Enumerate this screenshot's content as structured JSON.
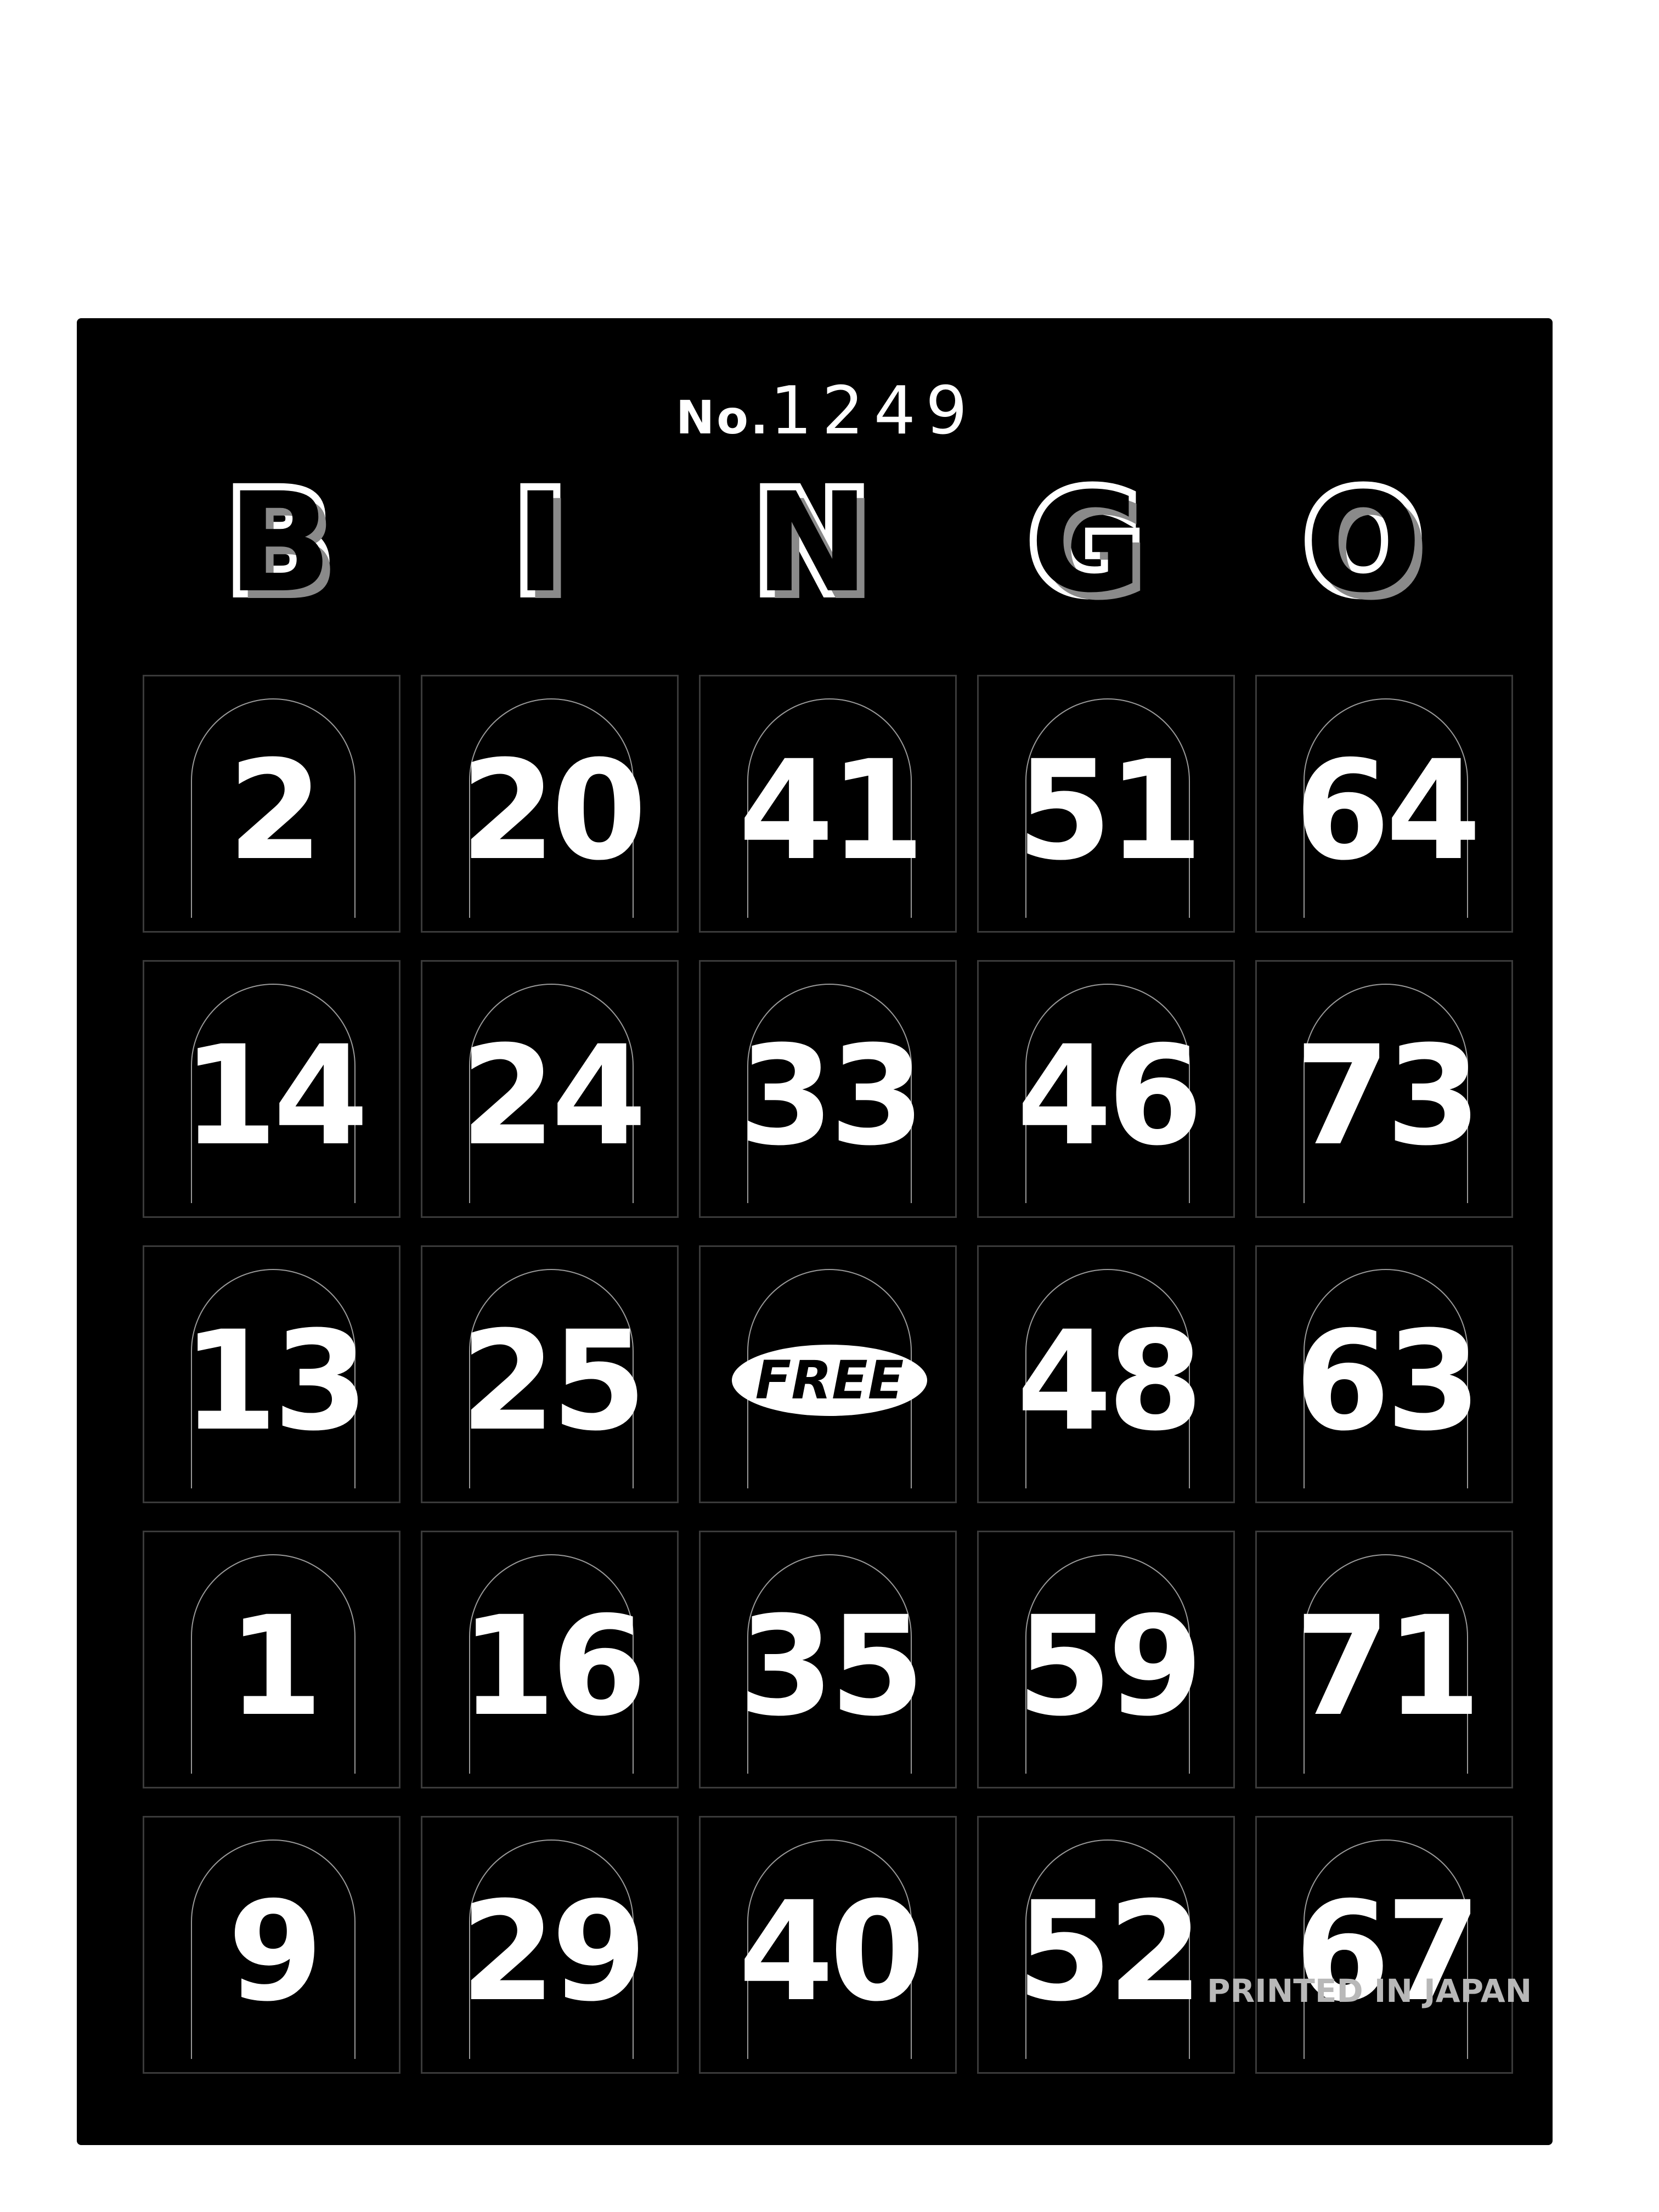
{
  "serial": {
    "label": "No.",
    "number": "1249"
  },
  "header_letters": [
    "B",
    "I",
    "N",
    "G",
    "O"
  ],
  "rows": [
    [
      "2",
      "20",
      "41",
      "51",
      "64"
    ],
    [
      "14",
      "24",
      "33",
      "46",
      "73"
    ],
    [
      "13",
      "25",
      "FREE",
      "48",
      "63"
    ],
    [
      "1",
      "16",
      "35",
      "59",
      "71"
    ],
    [
      "9",
      "29",
      "40",
      "52",
      "67"
    ]
  ],
  "free_space_label": "FREE",
  "footer": {
    "printed_text": "PRINTED IN JAPAN"
  },
  "colors": {
    "card": "#000000",
    "text": "#ffffff",
    "background": "#ffffff"
  }
}
